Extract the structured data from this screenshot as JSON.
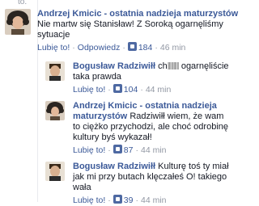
{
  "top_fragment": "to.",
  "comments": [
    {
      "author": "Andrzej Kmicic - ostatnia nadzieja maturzystów",
      "text": "Nie martw się Stanisław! Z Soroką ogarnęliśmy sytuacje",
      "like": "Lubię to!",
      "reply": "Odpowiedz",
      "likes": "184",
      "time": "46 min"
    },
    {
      "author": "Bogusław Radziwiłł",
      "text_before": "ch",
      "text_after": " ogarnęliście taka prawda",
      "like": "Lubię to!",
      "likes": "104",
      "time": "44 min"
    },
    {
      "author": "Andrzej Kmicic - ostatnia nadzieja maturzystów",
      "text": "Radziwiłł wiem, że wam to ciężko przychodzi, ale choć odrobinę kultury byś wykazał!",
      "like": "Lubię to!",
      "likes": "87",
      "time": "44 min"
    },
    {
      "author": "Bogusław Radziwiłł",
      "text": "Kulturę toś ty miał jak mi przy butach klęczałeś O! takiego wała",
      "like": "Lubię to!",
      "likes": "39",
      "time": "44 min"
    }
  ],
  "colors": {
    "link": "#3b5998",
    "meta": "#9197a3",
    "like_icon": "#4e69a2"
  },
  "icons": [
    "thumbs-up-icon"
  ]
}
